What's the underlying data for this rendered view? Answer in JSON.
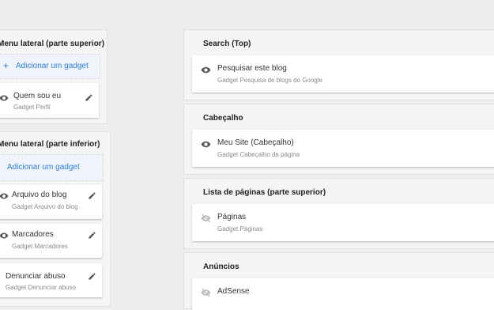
{
  "left_top": {
    "title": "Menu lateral (parte superior)",
    "add_label": "Adicionar um gadget",
    "gadgets": [
      {
        "title": "Quem sou eu",
        "subtitle": "Gadget Perfil",
        "icon": "eye-icon"
      }
    ]
  },
  "left_bottom": {
    "title": "Menu lateral (parte inferior)",
    "add_label": "Adicionar um gadget",
    "gadgets": [
      {
        "title": "Arquivo do blog",
        "subtitle": "Gadget Arquivo do blog",
        "icon": "eye-icon"
      },
      {
        "title": "Marcadores",
        "subtitle": "Gadget Marcadores",
        "icon": "eye-icon"
      },
      {
        "title": "Denunciar abuso",
        "subtitle": "Gadget Denunciar abuso",
        "icon": "eye-icon"
      }
    ]
  },
  "right": {
    "sections": [
      {
        "title": "Search (Top)",
        "gadget": {
          "title": "Pesquisar este blog",
          "subtitle": "Gadget Pesquisa de blogs do Google",
          "icon": "eye-icon"
        }
      },
      {
        "title": "Cabeçalho",
        "gadget": {
          "title": "Meu Site (Cabeçalho)",
          "subtitle": "Gadget Cabeçalho da página",
          "icon": "eye-icon"
        }
      },
      {
        "title": "Lista de páginas (parte superior)",
        "gadget": {
          "title": "Páginas",
          "subtitle": "Gadget Páginas",
          "icon": "eye-off-icon"
        }
      },
      {
        "title": "Anúncios",
        "gadget": {
          "title": "AdSense",
          "subtitle": "",
          "icon": "eye-off-icon"
        }
      }
    ]
  },
  "colors": {
    "accent": "#2a7de1",
    "background": "#eeeeee",
    "section": "#f5f5f5",
    "card": "#ffffff"
  }
}
